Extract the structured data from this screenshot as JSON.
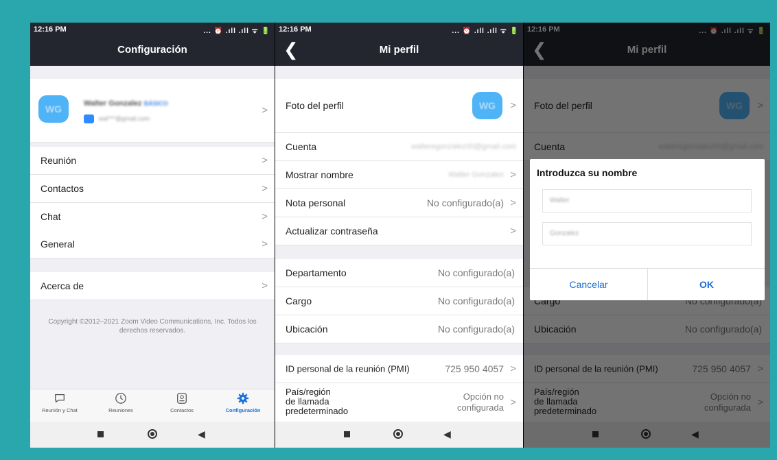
{
  "status_bar": {
    "time": "12:16 PM",
    "icons": "... ⏰ .ıll .ıll ᯤ 🔋"
  },
  "screen1": {
    "title": "Configuración",
    "profile": {
      "initials": "WG",
      "name": "Walter Gonzalez",
      "plan": "BÁSICO",
      "email": "wal***@gmail.com"
    },
    "items": [
      "Reunión",
      "Contactos",
      "Chat",
      "General"
    ],
    "about": "Acerca de",
    "copyright": "Copyright ©2012–2021 Zoom Video Communications, Inc. Todos los derechos reservados.",
    "tabs": [
      {
        "label": "Reunión y Chat",
        "icon": "chat-bubble-icon"
      },
      {
        "label": "Reuniones",
        "icon": "clock-icon"
      },
      {
        "label": "Contactos",
        "icon": "contact-icon"
      },
      {
        "label": "Configuración",
        "icon": "gear-icon"
      }
    ]
  },
  "screen2": {
    "title": "Mi perfil",
    "photo_label": "Foto del perfil",
    "account_label": "Cuenta",
    "account_value": "walteregonzalez00@gmail.com",
    "display_name_label": "Mostrar nombre",
    "display_name_value": "Walter Gonzalez",
    "note_label": "Nota personal",
    "note_value": "No configurado(a)",
    "password_label": "Actualizar contraseña",
    "department_label": "Departamento",
    "department_value": "No configurado(a)",
    "job_label": "Cargo",
    "job_value": "No configurado(a)",
    "location_label": "Ubicación",
    "location_value": "No configurado(a)",
    "pmi_label": "ID personal de la reunión (PMI)",
    "pmi_value": "725 950 4057",
    "country_label_1": "País/región",
    "country_label_2": "de llamada",
    "country_label_3": "predeterminado",
    "country_value_1": "Opción no",
    "country_value_2": "configurada"
  },
  "dialog": {
    "title": "Introduzca su nombre",
    "first_name": "Walter",
    "last_name": "Gonzalez",
    "cancel": "Cancelar",
    "ok": "OK"
  }
}
